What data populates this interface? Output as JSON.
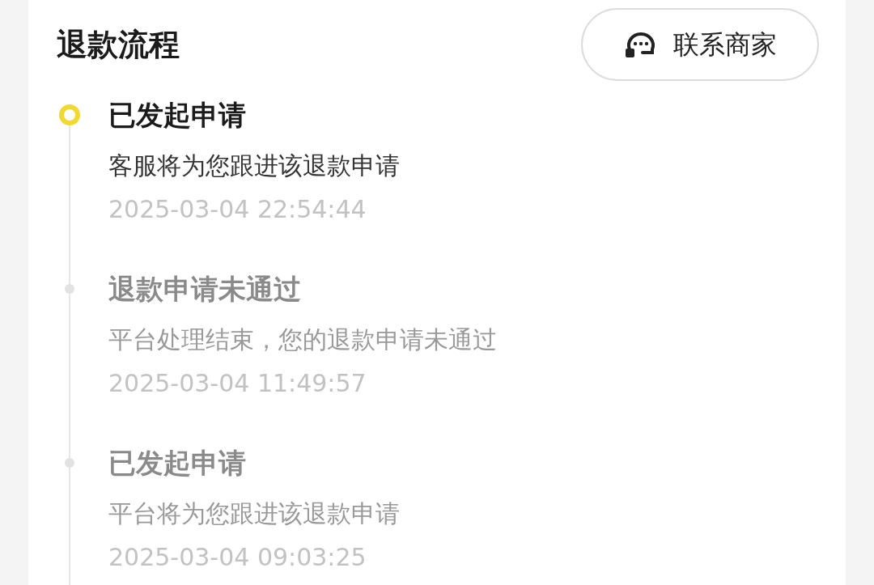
{
  "title": "退款流程",
  "contact_button": {
    "label": "联系商家"
  },
  "steps": [
    {
      "title": "已发起申请",
      "description": "客服将为您跟进该退款申请",
      "time": "2025-03-04 22:54:44",
      "current": true
    },
    {
      "title": "退款申请未通过",
      "description": "平台处理结束，您的退款申请未通过",
      "time": "2025-03-04 11:49:57",
      "current": false
    },
    {
      "title": "已发起申请",
      "description": "平台将为您跟进该退款申请",
      "time": "2025-03-04 09:03:25",
      "current": false
    }
  ]
}
